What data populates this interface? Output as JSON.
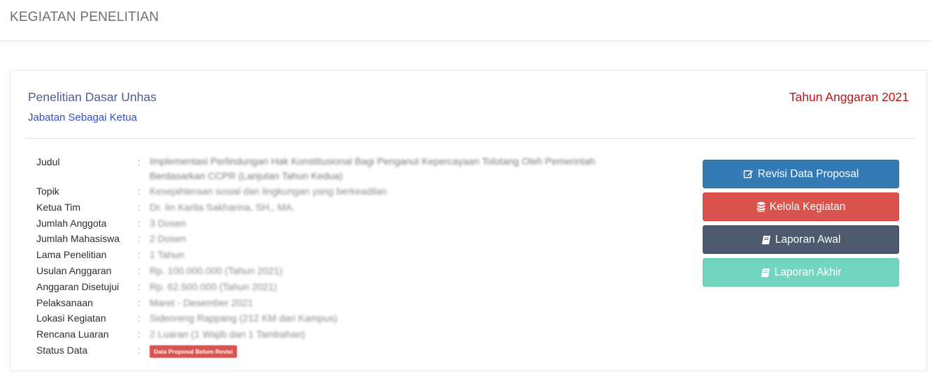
{
  "header": {
    "title": "KEGIATAN PENELITIAN"
  },
  "panel": {
    "title": "Penelitian Dasar Unhas",
    "subtitle": "Jabatan Sebagai Ketua",
    "tahun": "Tahun Anggaran 2021"
  },
  "details": [
    {
      "label": "Judul",
      "sep": ":",
      "value": "Implementasi Perlindungan Hak Konstitusional Bagi Penganut Kepercayaan Tolotang Oleh Pemerintah Berdasarkan CCPR (Lanjutan Tahun Kedua)"
    },
    {
      "label": "Topik",
      "sep": ":",
      "value": "Kesejahteraan sosial dan lingkungan yang berkeadilan"
    },
    {
      "label": "Ketua Tim",
      "sep": ":",
      "value": "Dr. Iin Karita Sakharina, SH., MA."
    },
    {
      "label": "Jumlah Anggota",
      "sep": ":",
      "value": "3 Dosen"
    },
    {
      "label": "Jumlah Mahasiswa",
      "sep": ":",
      "value": "2 Dosen"
    },
    {
      "label": "Lama Penelitian",
      "sep": ":",
      "value": "1 Tahun"
    },
    {
      "label": "Usulan Anggaran",
      "sep": ":",
      "value": "Rp. 100.000.000 (Tahun 2021)"
    },
    {
      "label": "Anggaran Disetujui",
      "sep": ":",
      "value": "Rp. 62.500.000 (Tahun 2021)"
    },
    {
      "label": "Pelaksanaan",
      "sep": ":",
      "value": "Maret - Desember 2021"
    },
    {
      "label": "Lokasi Kegiatan",
      "sep": ":",
      "value": "Sidenreng Rappang (212 KM dari Kampus)"
    },
    {
      "label": "Rencana Luaran",
      "sep": ":",
      "value": "2 Luaran (1 Wajib dan 1 Tambahan)"
    },
    {
      "label": "Status Data",
      "sep": ":",
      "value": "Data Proposal Belum Revisi"
    }
  ],
  "actions": {
    "revisi": "Revisi Data Proposal",
    "kelola": "Kelola Kegiatan",
    "awal": "Laporan Awal",
    "akhir": "Laporan Akhir"
  },
  "icons": {
    "revisi": "edit-icon",
    "kelola": "database-icon",
    "awal": "book-icon",
    "akhir": "book-icon"
  },
  "colors": {
    "revisi": "#337ab7",
    "kelola": "#d9534f",
    "awal": "#4b5a6d",
    "akhir": "#72d5c0",
    "tahun": "#b01818",
    "status_badge": "#d9534f"
  }
}
